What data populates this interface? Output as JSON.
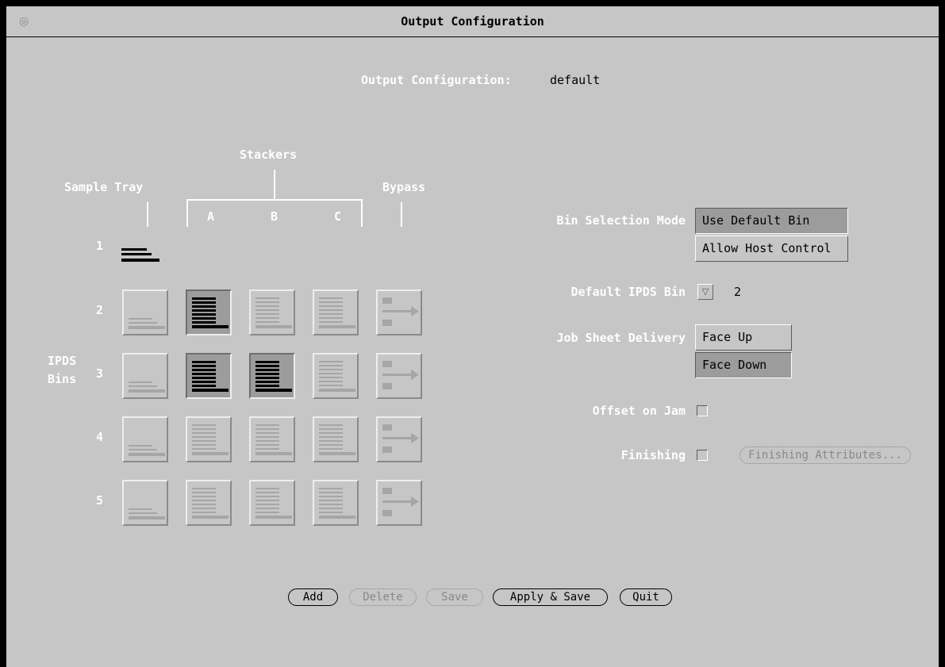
{
  "window": {
    "title": "Output Configuration",
    "icon": "globe-icon"
  },
  "config": {
    "label": "Output Configuration:",
    "value": "default"
  },
  "bin_grid": {
    "header_stackers": "Stackers",
    "header_sample_tray": "Sample Tray",
    "header_bypass": "Bypass",
    "stacker_cols": [
      "A",
      "B",
      "C"
    ],
    "side_label_line1": "IPDS",
    "side_label_line2": "Bins",
    "row_labels": [
      "1",
      "2",
      "3",
      "4",
      "5"
    ],
    "selected": [
      [
        2,
        "A"
      ],
      [
        3,
        "A"
      ],
      [
        3,
        "B"
      ]
    ]
  },
  "settings": {
    "bin_selection_label": "Bin Selection Mode",
    "bin_selection_options": [
      "Use Default Bin",
      "Allow Host Control"
    ],
    "bin_selection_selected": "Use Default Bin",
    "default_bin_label": "Default IPDS Bin",
    "default_bin_value": "2",
    "job_sheet_label": "Job Sheet Delivery",
    "job_sheet_options": [
      "Face Up",
      "Face Down"
    ],
    "job_sheet_selected": "Face Down",
    "offset_label": "Offset on Jam",
    "offset_checked": false,
    "finishing_label": "Finishing",
    "finishing_checked": false,
    "finishing_attributes_label": "Finishing Attributes..."
  },
  "buttons": {
    "add": "Add",
    "delete": "Delete",
    "save": "Save",
    "apply_save": "Apply & Save",
    "quit": "Quit"
  }
}
